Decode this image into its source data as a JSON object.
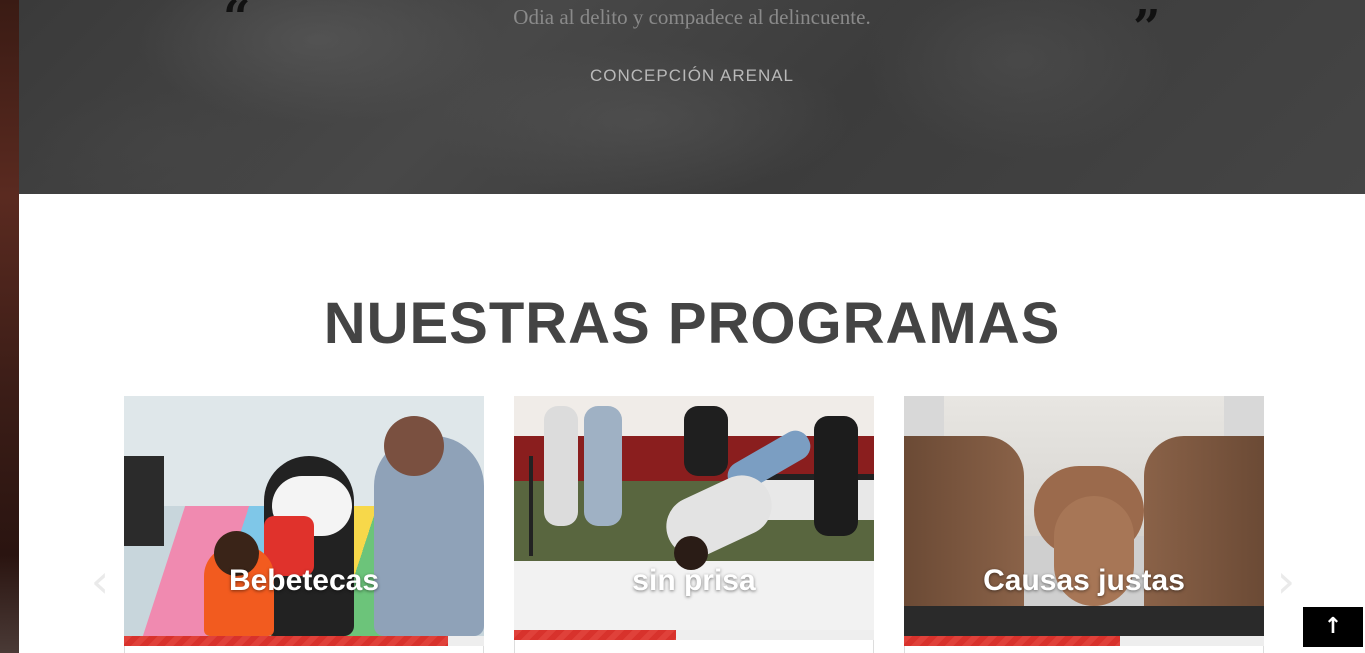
{
  "quote": {
    "open_mark": "“",
    "close_mark": "”",
    "text": "Odia al delito y compadece al delincuente.",
    "author": "CONCEPCIÓN ARENAL"
  },
  "section": {
    "title": "NUESTRAS PROGRAMAS"
  },
  "programs": [
    {
      "title": "Bebetecas",
      "progress": 0.9,
      "icon": "photo-children-playroom"
    },
    {
      "title": "sin prisa",
      "progress": 0.45,
      "icon": "photo-breakdancer"
    },
    {
      "title": "Causas justas",
      "progress": 0.6,
      "icon": "photo-clasped-hands"
    }
  ],
  "carousel": {
    "prev_glyph": "‹",
    "next_glyph": "›"
  },
  "back_to_top": {
    "glyph": "↑"
  },
  "colors": {
    "progress": "#e0413a",
    "title": "#444444",
    "quote_text": "#8a8a8a"
  }
}
